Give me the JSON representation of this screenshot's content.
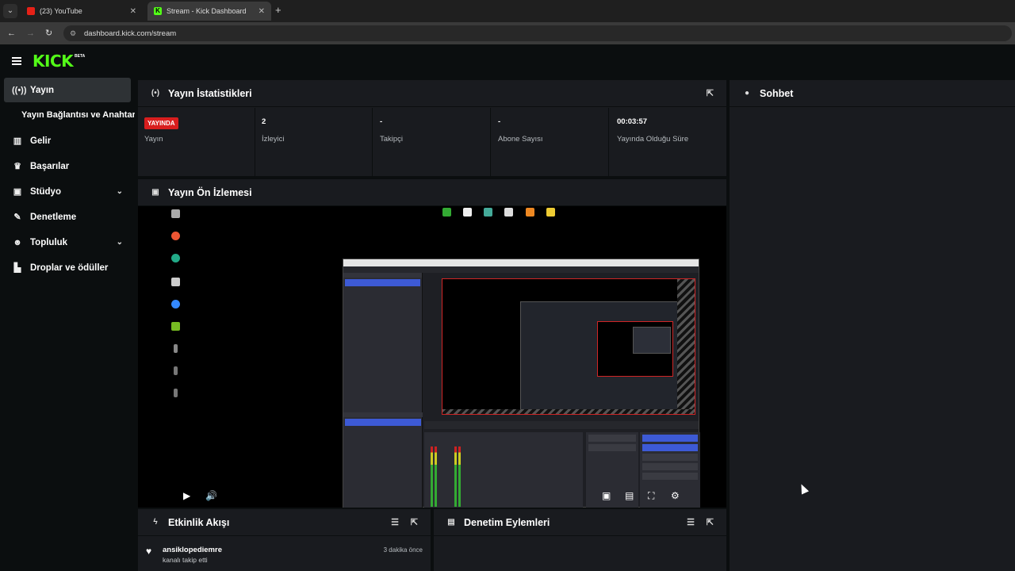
{
  "browser": {
    "tabs": [
      {
        "title": "(23) YouTube",
        "favicon": "youtube-icon"
      },
      {
        "title": "Stream - Kick Dashboard",
        "favicon": "kick-icon",
        "active": true
      }
    ],
    "url": "dashboard.kick.com/stream"
  },
  "brand": {
    "logo": "KICK",
    "badge": "BETA",
    "accent": "#53fc18"
  },
  "sidebar": {
    "items": [
      {
        "label": "Yayın",
        "icon": "broadcast-icon",
        "active": true
      },
      {
        "label": "Yayın Bağlantısı ve Anahtarı",
        "sub": true
      },
      {
        "label": "Gelir",
        "icon": "chart-icon"
      },
      {
        "label": "Başarılar",
        "icon": "trophy-icon"
      },
      {
        "label": "Stüdyo",
        "icon": "studio-icon",
        "expandable": true
      },
      {
        "label": "Denetleme",
        "icon": "wrench-icon"
      },
      {
        "label": "Topluluk",
        "icon": "people-icon",
        "expandable": true
      },
      {
        "label": "Droplar ve ödüller",
        "icon": "gift-icon"
      }
    ]
  },
  "stats": {
    "title": "Yayın İstatistikleri",
    "live_badge": "YAYINDA",
    "items": [
      {
        "value": "",
        "label": "Yayın"
      },
      {
        "value": "2",
        "label": "İzleyici"
      },
      {
        "value": "-",
        "label": "Takipçi"
      },
      {
        "value": "-",
        "label": "Abone Sayısı"
      },
      {
        "value": "00:03:57",
        "label": "Yayında Olduğu Süre"
      }
    ]
  },
  "preview": {
    "title": "Yayın Ön İzlemesi"
  },
  "chat": {
    "title": "Sohbet"
  },
  "events": {
    "title": "Etkinlik Akışı",
    "items": [
      {
        "user": "ansiklopediemre",
        "text": "kanalı takip etti",
        "time": "3 dakika önce",
        "icon": "heart-icon"
      }
    ]
  },
  "moderation": {
    "title": "Denetim Eylemleri"
  },
  "colors": {
    "live_red": "#d81e1e",
    "panel_bg": "#191b1f",
    "page_bg": "#0b0e0f"
  }
}
